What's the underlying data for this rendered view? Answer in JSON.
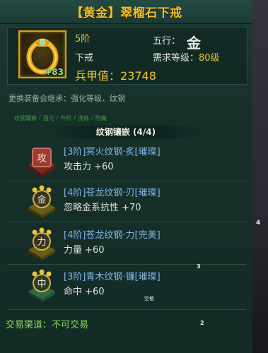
{
  "title": "【黄金】翠榴石下戒",
  "item": {
    "enhance_level": "+83",
    "stage": "5阶",
    "slot": "下戒",
    "element_label": "五行：",
    "element_glyph": "金",
    "req_level_label": "需求等级：",
    "req_level_value": "80级",
    "power_label": "兵甲值：",
    "power_value": "23748"
  },
  "inherit_note": "更换装备会继承：强化等级、纹钢",
  "tabs": [
    "纹钢镶嵌",
    "/",
    "强化",
    "/",
    "升阶",
    "/",
    "洗练",
    "/",
    "附魔"
  ],
  "section_title": "纹钢镶嵌 (4/4)",
  "gems": [
    {
      "glyph": "攻",
      "name": "[3阶]冥火纹钢·炙[璀璨]",
      "stat": "攻击力 +60",
      "base_color": "#a23a32"
    },
    {
      "glyph": "金",
      "name": "[4阶]苍龙纹钢·刃[璀璨]",
      "stat": "忽略金系抗性 +70",
      "base_color": "#b59a2a"
    },
    {
      "glyph": "力",
      "name": "[4阶]苍龙纹钢·力[完美]",
      "stat": "力量 +60",
      "base_color": "#b59a2a"
    },
    {
      "glyph": "中",
      "name": "[3阶]青木纹钢·镰[璀璨]",
      "stat": "命中 +60",
      "base_color": "#3d8a5a"
    }
  ],
  "trade": "交易渠道：不可交易",
  "markers": {
    "right": "4",
    "m3": "3",
    "m2": "2",
    "small": "空格"
  }
}
